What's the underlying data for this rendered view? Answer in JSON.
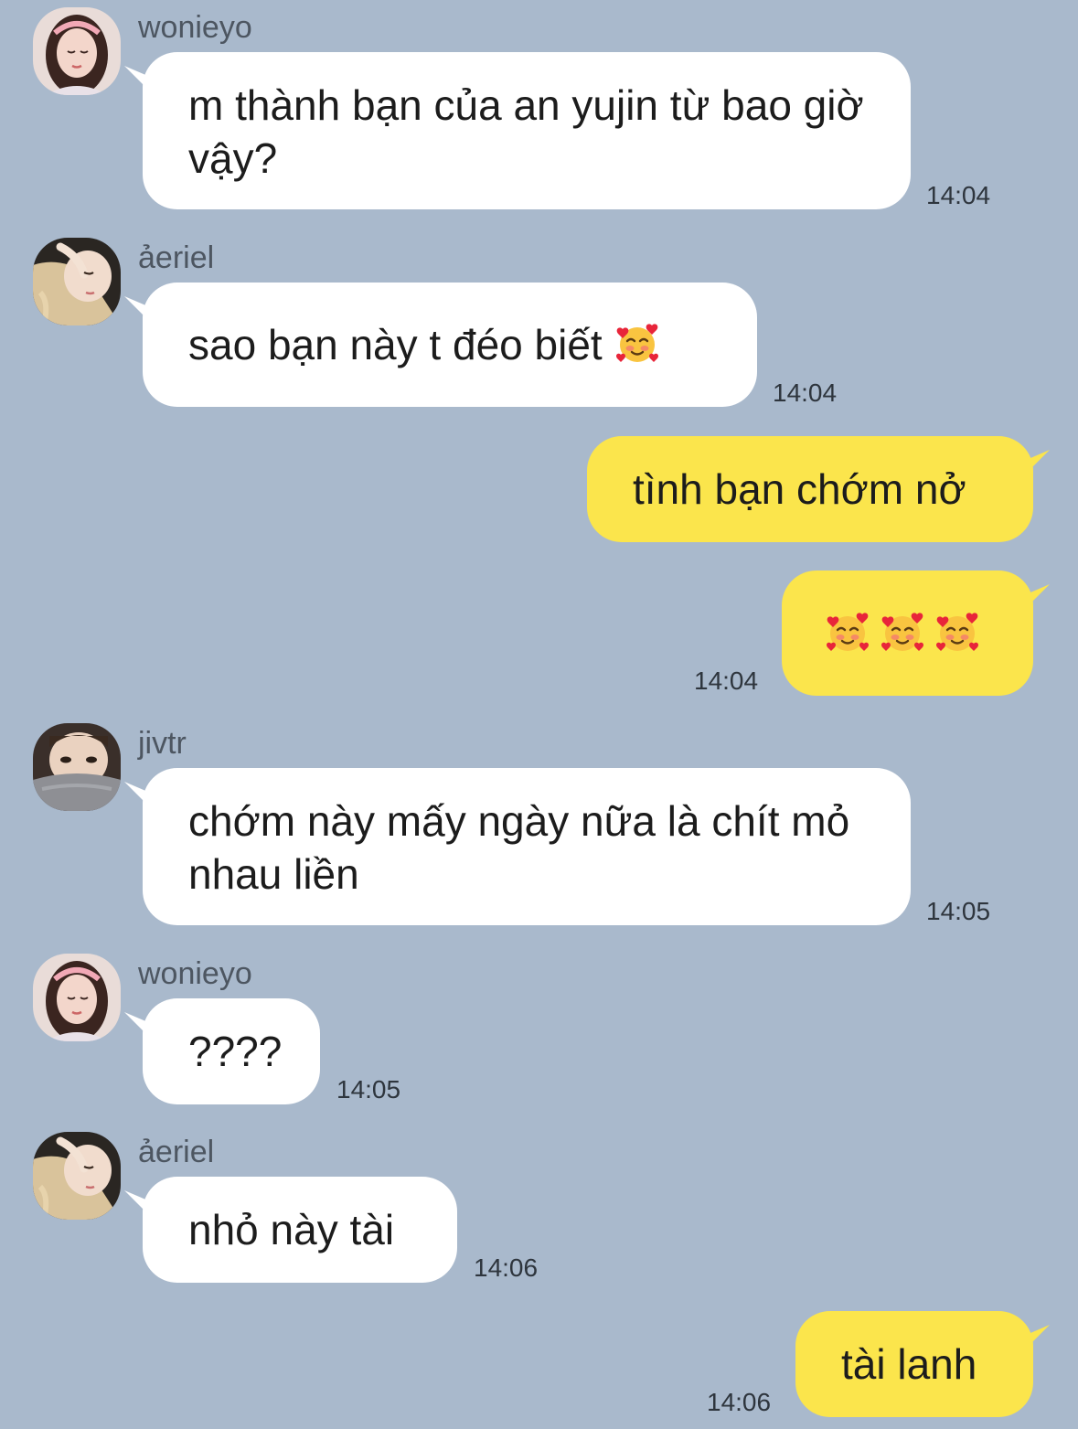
{
  "colors": {
    "background": "#a9b9cc",
    "incoming_bubble": "#ffffff",
    "outgoing_bubble": "#fbe54c"
  },
  "messages": [
    {
      "sender": "wonieyo",
      "text": "m thành bạn của an yujin từ bao giờ vậy?",
      "time": "14:04",
      "direction": "in"
    },
    {
      "sender": "ảeriel",
      "text": "sao bạn này t đéo biết",
      "emoji": "smiling-face-with-hearts-icon",
      "time": "14:04",
      "direction": "in"
    },
    {
      "text": "tình bạn chớm nở",
      "direction": "out"
    },
    {
      "emoji_count": 3,
      "emoji": "smiling-face-with-hearts-icon",
      "time": "14:04",
      "direction": "out"
    },
    {
      "sender": "jivtr",
      "text": "chớm này mấy ngày nữa là chít mỏ nhau liền",
      "time": "14:05",
      "direction": "in"
    },
    {
      "sender": "wonieyo",
      "text": "????",
      "time": "14:05",
      "direction": "in"
    },
    {
      "sender": "ảeriel",
      "text": "nhỏ này tài",
      "time": "14:06",
      "direction": "in"
    },
    {
      "text": "tài lanh",
      "time": "14:06",
      "direction": "out"
    }
  ]
}
